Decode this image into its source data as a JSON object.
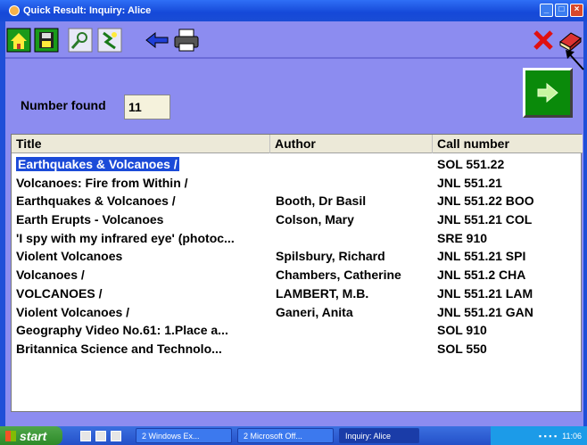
{
  "window": {
    "title": "Quick Result: Inquiry: Alice"
  },
  "toolbar": {
    "icons": [
      "home-icon",
      "save-disk-icon",
      "search-icon",
      "plugin-icon",
      "back-arrow-icon",
      "print-icon",
      "close-x-icon",
      "book-icon"
    ]
  },
  "summary": {
    "number_found_label": "Number found",
    "number_found_value": "11"
  },
  "table": {
    "columns": [
      "Title",
      "Author",
      "Call number"
    ],
    "rows": [
      {
        "title": "Earthquakes & Volcanoes /",
        "author": "",
        "call": "SOL 551.22"
      },
      {
        "title": "Volcanoes: Fire from Within /",
        "author": "",
        "call": "JNL 551.21"
      },
      {
        "title": "Earthquakes & Volcanoes /",
        "author": "Booth, Dr Basil",
        "call": "JNL 551.22 BOO"
      },
      {
        "title": "Earth Erupts - Volcanoes",
        "author": "Colson, Mary",
        "call": "JNL 551.21 COL"
      },
      {
        "title": "'I spy with my infrared eye' (photoc...",
        "author": "",
        "call": "SRE 910"
      },
      {
        "title": "Violent Volcanoes",
        "author": "Spilsbury, Richard",
        "call": "JNL 551.21 SPI"
      },
      {
        "title": "Volcanoes /",
        "author": "Chambers, Catherine",
        "call": "JNL 551.2 CHA"
      },
      {
        "title": "VOLCANOES /",
        "author": "LAMBERT, M.B.",
        "call": "JNL 551.21 LAM"
      },
      {
        "title": "Violent Volcanoes /",
        "author": "Ganeri, Anita",
        "call": "JNL 551.21 GAN"
      },
      {
        "title": "Geography Video No.61: 1.Place a...",
        "author": "",
        "call": "SOL 910"
      },
      {
        "title": "Britannica Science and Technolo...",
        "author": "",
        "call": "SOL 550"
      }
    ]
  },
  "taskbar": {
    "start": "start",
    "tasks": [
      "2 Windows Ex...",
      "2 Microsoft Off...",
      "Inquiry: Alice"
    ],
    "clock": "11:06"
  }
}
